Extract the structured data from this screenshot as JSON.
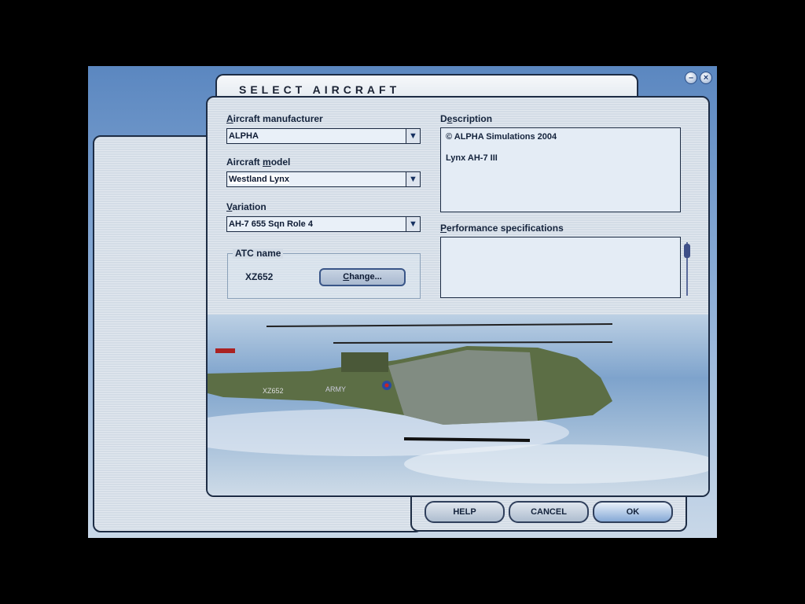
{
  "window": {
    "title": "SELECT AIRCRAFT",
    "minimize_icon": "minimize-icon",
    "close_icon": "close-icon"
  },
  "manufacturer": {
    "label_key": "A",
    "label_rest": "ircraft manufacturer",
    "value": "ALPHA"
  },
  "model": {
    "label_pre": "Aircraft ",
    "label_key": "m",
    "label_rest": "odel",
    "value": "Westland Lynx"
  },
  "variation": {
    "label_key": "V",
    "label_rest": "ariation",
    "value": "AH-7 655 Sqn Role 4"
  },
  "atc": {
    "legend": "ATC name",
    "value": "XZ652",
    "change_key": "C",
    "change_rest": "hange..."
  },
  "description": {
    "label_pre": "D",
    "label_key": "e",
    "label_rest": "scription",
    "line1": "© ALPHA Simulations 2004",
    "line2": "Lynx AH-7 III"
  },
  "performance": {
    "label_key": "P",
    "label_rest": "erformance specifications",
    "text": ""
  },
  "buttons": {
    "help": "HELP",
    "cancel": "CANCEL",
    "ok": "OK"
  },
  "preview": {
    "aircraft_marking": "XZ652",
    "aircraft_text": "ARMY"
  }
}
